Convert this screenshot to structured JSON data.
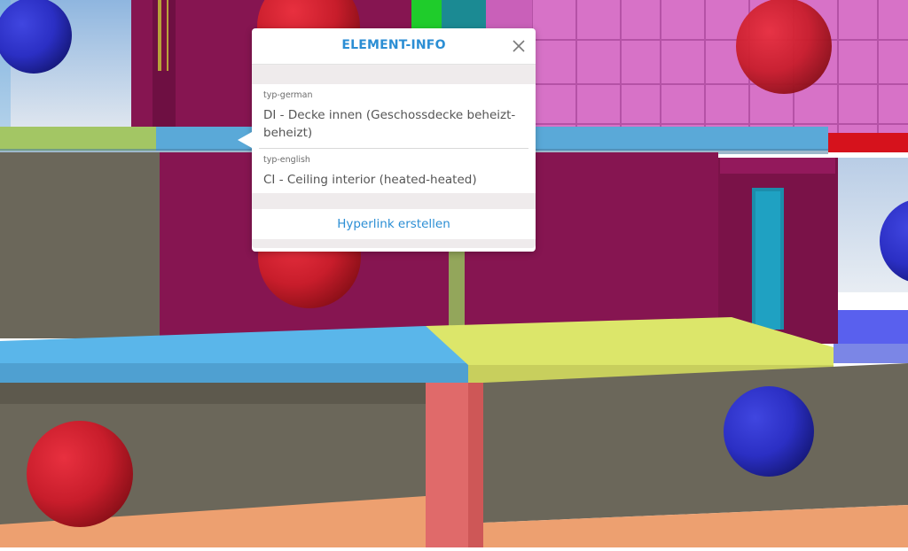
{
  "popup": {
    "title": "ELEMENT-INFO",
    "fields": [
      {
        "label": "typ-german",
        "value": "DI - Decke innen (Geschossdecke beheizt-beheizt)"
      },
      {
        "label": "typ-english",
        "value": "CI - Ceiling interior (heated-heated)"
      }
    ],
    "hyperlink_label": "Hyperlink erstellen"
  },
  "colors": {
    "accent": "#2b8ed4",
    "wall_magenta": "#861551",
    "wall_pink": "#d772c7",
    "floor_blue": "#5ab6ea",
    "floor_yellow": "#dce66a",
    "wall_gray": "#6b675a",
    "floor_orange": "#eda070",
    "wall_salmon": "#e06a6a",
    "marker_red": "#d01f2e",
    "marker_blue": "#2c31c7"
  }
}
